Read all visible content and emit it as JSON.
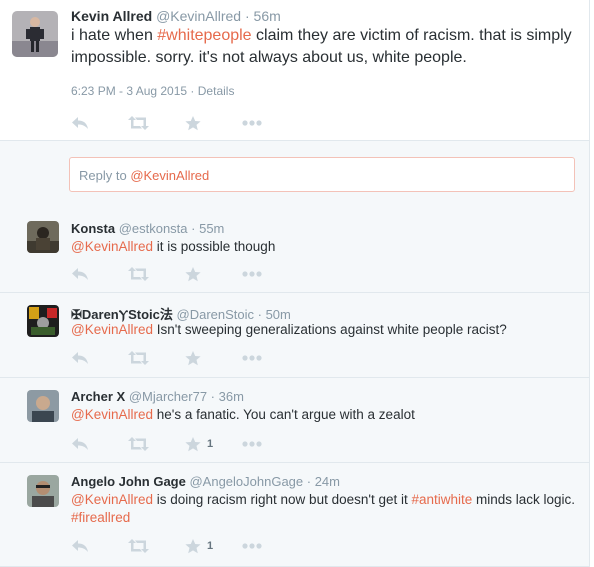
{
  "main_tweet": {
    "fullname": "Kevin Allred",
    "username": "@KevinAllred",
    "time_ago": "56m",
    "text_1": "i hate when ",
    "hashtag": "#whitepeople",
    "text_2": " claim they are victim of racism. that is simply impossible. sorry. it's not always about us, white people.",
    "date": "6:23 PM - 3 Aug 2015",
    "details_link": "Details"
  },
  "reply_box": {
    "prefix": "Reply to ",
    "mention": "@KevinAllred"
  },
  "replies": [
    {
      "fullname": "Konsta",
      "username": "@estkonsta",
      "time_ago": "55m",
      "mention": "@KevinAllred",
      "text": " it is possible though",
      "hashtag": "",
      "text_2": "",
      "like_count": ""
    },
    {
      "fullname": "✠DarenⲨStoic法",
      "username": "@DarenStoic",
      "time_ago": "50m",
      "mention": "@KevinAllred",
      "text": " Isn't sweeping generalizations against white people racist?",
      "hashtag": "",
      "text_2": "",
      "like_count": ""
    },
    {
      "fullname": "Archer X",
      "username": "@Mjarcher77",
      "time_ago": "36m",
      "mention": "@KevinAllred",
      "text": " he's a fanatic. You can't argue with a zealot",
      "hashtag": "",
      "text_2": "",
      "like_count": "1"
    },
    {
      "fullname": "Angelo John Gage",
      "username": "@AngeloJohnGage",
      "time_ago": "24m",
      "mention": "@KevinAllred",
      "text": " is doing racism right now but doesn't get it ",
      "hashtag": "#antiwhite",
      "text_2": " minds lack logic. ",
      "hashtag_2": "#fireallred",
      "like_count": "1"
    }
  ],
  "icons": [
    "reply-icon",
    "retweet-icon",
    "favorite-icon",
    "more-icon"
  ],
  "colors": {
    "link": "#e66a4c",
    "meta": "#8899a6",
    "action_icon": "#ccd6dd",
    "reply_bg": "#f5f8fa"
  },
  "separator": " · "
}
